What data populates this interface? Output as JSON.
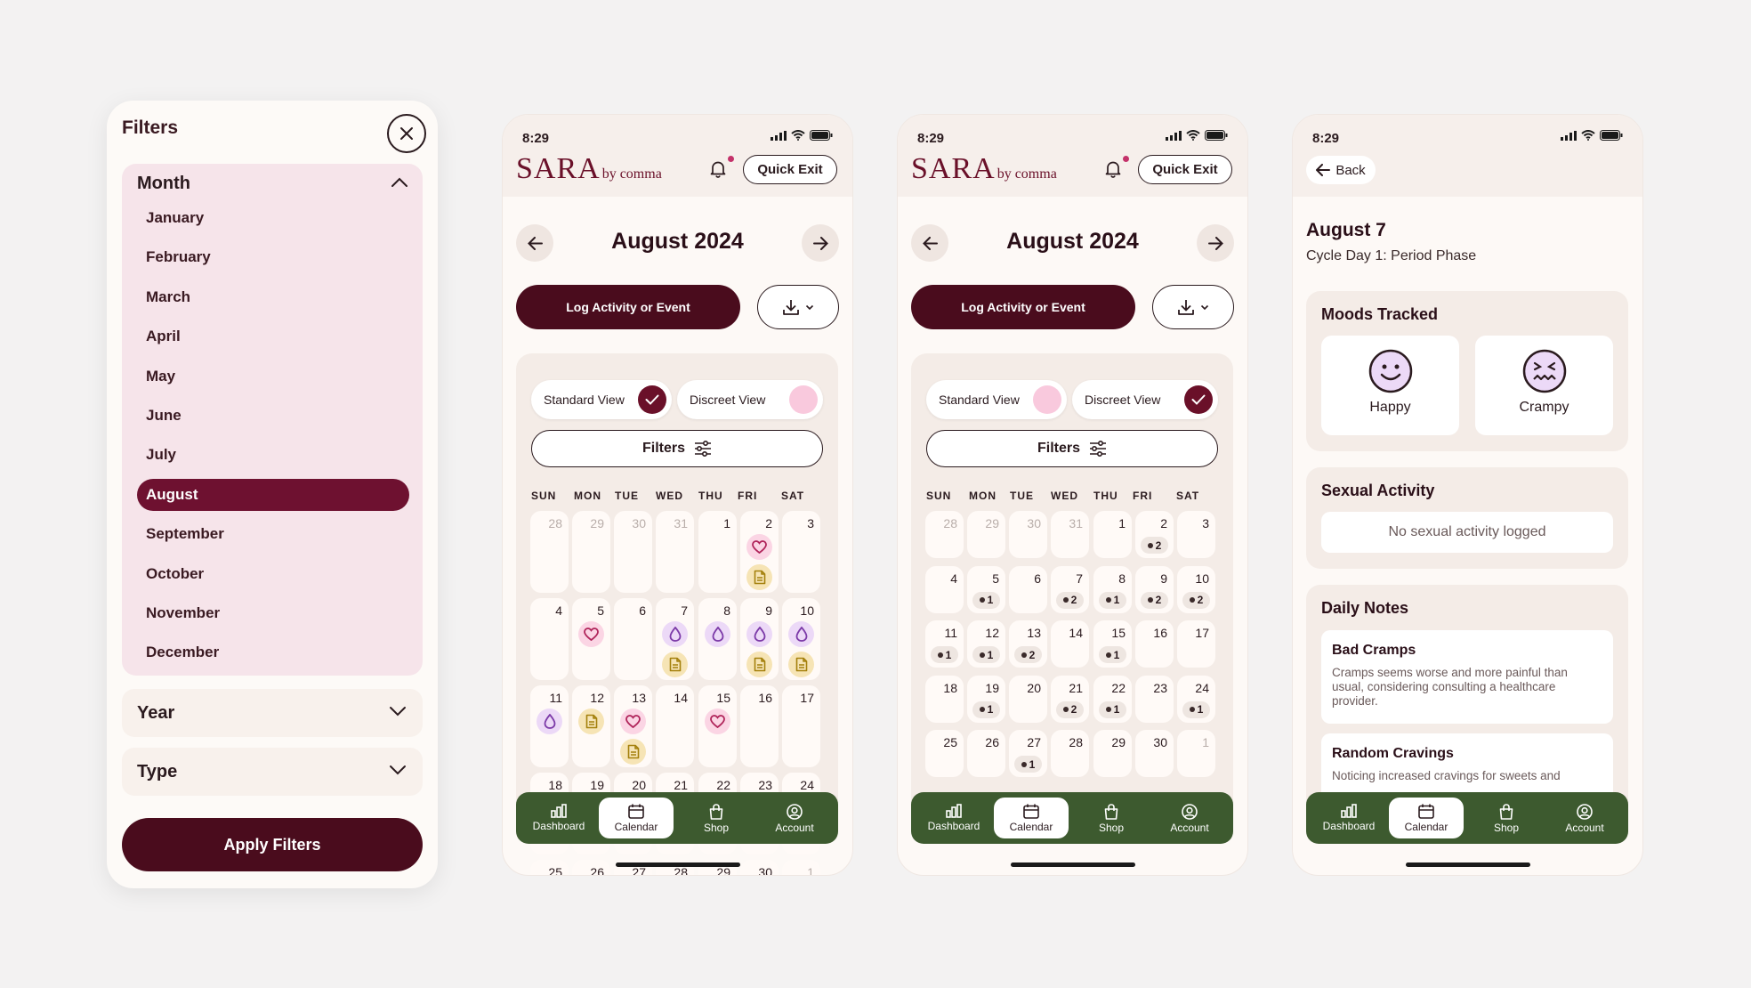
{
  "filters": {
    "title": "Filters",
    "month_header": "Month",
    "months": [
      "January",
      "February",
      "March",
      "April",
      "May",
      "June",
      "July",
      "August",
      "September",
      "October",
      "November",
      "December"
    ],
    "selected_month": "August",
    "year_header": "Year",
    "type_header": "Type",
    "apply_label": "Apply Filters"
  },
  "status": {
    "time": "8:29"
  },
  "header": {
    "logo_main": "SARA",
    "logo_sub": "by comma",
    "quick_exit": "Quick Exit"
  },
  "calendar": {
    "month_title": "August 2024",
    "log_button": "Log Activity or Event",
    "standard_view": "Standard View",
    "discreet_view": "Discreet View",
    "filters_button": "Filters",
    "days_of_week": [
      "SUN",
      "MON",
      "TUE",
      "WED",
      "THU",
      "FRI",
      "SAT"
    ],
    "standard_rows": [
      [
        {
          "d": "28",
          "dim": true
        },
        {
          "d": "29",
          "dim": true
        },
        {
          "d": "30",
          "dim": true
        },
        {
          "d": "31",
          "dim": true
        },
        {
          "d": "1"
        },
        {
          "d": "2",
          "icons": [
            "heart",
            "note"
          ]
        },
        {
          "d": "3"
        }
      ],
      [
        {
          "d": "4"
        },
        {
          "d": "5",
          "icons": [
            "heart"
          ]
        },
        {
          "d": "6"
        },
        {
          "d": "7",
          "icons": [
            "drop",
            "note"
          ]
        },
        {
          "d": "8",
          "icons": [
            "drop"
          ]
        },
        {
          "d": "9",
          "icons": [
            "drop",
            "note"
          ]
        },
        {
          "d": "10",
          "icons": [
            "drop",
            "note"
          ]
        }
      ],
      [
        {
          "d": "11",
          "icons": [
            "drop"
          ]
        },
        {
          "d": "12",
          "icons": [
            "note"
          ]
        },
        {
          "d": "13",
          "icons": [
            "heart",
            "note"
          ]
        },
        {
          "d": "14"
        },
        {
          "d": "15",
          "icons": [
            "heart"
          ]
        },
        {
          "d": "16"
        },
        {
          "d": "17"
        }
      ],
      [
        {
          "d": "18"
        },
        {
          "d": "19"
        },
        {
          "d": "20"
        },
        {
          "d": "21"
        },
        {
          "d": "22"
        },
        {
          "d": "23"
        },
        {
          "d": "24"
        }
      ],
      [
        {
          "d": "25"
        },
        {
          "d": "26"
        },
        {
          "d": "27"
        },
        {
          "d": "28"
        },
        {
          "d": "29"
        },
        {
          "d": "30"
        },
        {
          "d": "1",
          "dim": true
        }
      ]
    ],
    "discreet_rows": [
      [
        {
          "d": "28",
          "dim": true
        },
        {
          "d": "29",
          "dim": true
        },
        {
          "d": "30",
          "dim": true
        },
        {
          "d": "31",
          "dim": true
        },
        {
          "d": "1"
        },
        {
          "d": "2",
          "c": "2"
        },
        {
          "d": "3"
        }
      ],
      [
        {
          "d": "4"
        },
        {
          "d": "5",
          "c": "1"
        },
        {
          "d": "6"
        },
        {
          "d": "7",
          "c": "2"
        },
        {
          "d": "8",
          "c": "1"
        },
        {
          "d": "9",
          "c": "2"
        },
        {
          "d": "10",
          "c": "2"
        }
      ],
      [
        {
          "d": "11",
          "c": "1"
        },
        {
          "d": "12",
          "c": "1"
        },
        {
          "d": "13",
          "c": "2"
        },
        {
          "d": "14"
        },
        {
          "d": "15",
          "c": "1"
        },
        {
          "d": "16"
        },
        {
          "d": "17"
        }
      ],
      [
        {
          "d": "18"
        },
        {
          "d": "19",
          "c": "1"
        },
        {
          "d": "20"
        },
        {
          "d": "21",
          "c": "2"
        },
        {
          "d": "22",
          "c": "1"
        },
        {
          "d": "23"
        },
        {
          "d": "24",
          "c": "1"
        }
      ],
      [
        {
          "d": "25"
        },
        {
          "d": "26"
        },
        {
          "d": "27",
          "c": "1"
        },
        {
          "d": "28"
        },
        {
          "d": "29"
        },
        {
          "d": "30"
        },
        {
          "d": "1",
          "dim": true
        }
      ]
    ]
  },
  "nav": {
    "dashboard": "Dashboard",
    "calendar": "Calendar",
    "shop": "Shop",
    "account": "Account"
  },
  "detail": {
    "back": "Back",
    "date": "August 7",
    "cycle": "Cycle Day 1: Period Phase",
    "moods_title": "Moods Tracked",
    "mood1": "Happy",
    "mood2": "Crampy",
    "sexual_title": "Sexual Activity",
    "sexual_empty": "No sexual activity logged",
    "notes_title": "Daily Notes",
    "note1_title": "Bad Cramps",
    "note1_body": "Cramps seems worse and more painful than usual, considering consulting a healthcare provider.",
    "note2_title": "Random Cravings",
    "note2_body": "Noticing increased cravings for sweets and"
  },
  "colors": {
    "primary": "#4a0c1d",
    "accent": "#6e1130",
    "nav": "#3d5a2f",
    "heart": "#fbd5e4",
    "drop": "#ecd9f7",
    "note": "#f6e4b5"
  },
  "icons": [
    "close-icon",
    "chevron-up-icon",
    "chevron-down-icon",
    "bell-icon",
    "arrow-left-icon",
    "arrow-right-icon",
    "download-icon",
    "check-icon",
    "sliders-icon",
    "heart-icon",
    "drop-icon",
    "note-icon",
    "dashboard-icon",
    "calendar-icon",
    "shop-icon",
    "account-icon",
    "happy-face-icon",
    "crampy-face-icon"
  ]
}
